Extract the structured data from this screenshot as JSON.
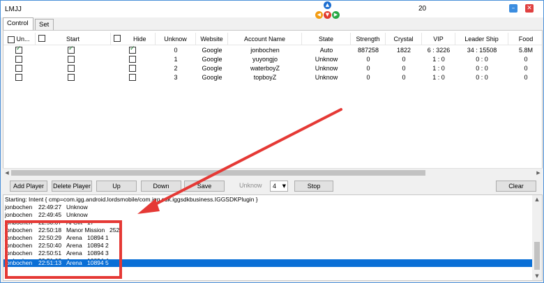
{
  "window": {
    "title": "LMJJ",
    "counter": "20",
    "minimize_icon": "minimize-icon",
    "close_icon": "close-icon"
  },
  "dpad": {
    "up": "▲",
    "left": "◀",
    "down": "▼",
    "right": "▶"
  },
  "tabs": [
    {
      "label": "Control",
      "active": true
    },
    {
      "label": "Set",
      "active": false
    }
  ],
  "grid": {
    "columns": [
      "Un...",
      "Start",
      "Hide",
      "Unknow",
      "Website",
      "Account Name",
      "State",
      "Strength",
      "Crystal",
      "VIP",
      "Leader Ship",
      "Food"
    ],
    "rows": [
      {
        "un": true,
        "start": true,
        "hide": true,
        "unknow": "0",
        "website": "Google",
        "account": "jonbochen",
        "state": "Auto",
        "strength": "887258",
        "crystal": "1822",
        "vip": "6 : 3226",
        "leadership": "34 : 15508",
        "food": "5.8M"
      },
      {
        "un": false,
        "start": false,
        "hide": false,
        "unknow": "1",
        "website": "Google",
        "account": "yuyongjo",
        "state": "Unknow",
        "strength": "0",
        "crystal": "0",
        "vip": "1 : 0",
        "leadership": "0 : 0",
        "food": "0"
      },
      {
        "un": false,
        "start": false,
        "hide": false,
        "unknow": "2",
        "website": "Google",
        "account": "waterboyZ",
        "state": "Unknow",
        "strength": "0",
        "crystal": "0",
        "vip": "1 : 0",
        "leadership": "0 : 0",
        "food": "0"
      },
      {
        "un": false,
        "start": false,
        "hide": false,
        "unknow": "3",
        "website": "Google",
        "account": "topboyZ",
        "state": "Unknow",
        "strength": "0",
        "crystal": "0",
        "vip": "1 : 0",
        "leadership": "0 : 0",
        "food": "0"
      }
    ]
  },
  "toolbar": {
    "add_player": "Add Player",
    "delete_player": "Delete Player",
    "up": "Up",
    "down": "Down",
    "save": "Save",
    "unknow_label": "Unknow",
    "select_value": "4",
    "stop": "Stop",
    "clear": "Clear"
  },
  "log": {
    "lines": [
      {
        "name": "Starting: Intent { cmp=com.igg.android.lordsmobile/com.igg.sdk.iggsdkbusiness.IGGSDKPlugin }",
        "time": "",
        "action": "",
        "value": ""
      },
      {
        "name": "jonbochen",
        "time": "22:49:27",
        "action": "Unknow",
        "value": ""
      },
      {
        "name": "jonbochen",
        "time": "22:49:45",
        "action": "Unknow",
        "value": ""
      },
      {
        "name": "jonbochen",
        "time": "22:50:07",
        "action": "Al Gift",
        "value": "17"
      },
      {
        "name": "jonbochen",
        "time": "22:50:18",
        "action": "Manor Mission",
        "value": "252"
      },
      {
        "name": "jonbochen",
        "time": "22:50:29",
        "action": "Arena",
        "value": "10894 1"
      },
      {
        "name": "jonbochen",
        "time": "22:50:40",
        "action": "Arena",
        "value": "10894 2"
      },
      {
        "name": "jonbochen",
        "time": "22:50:51",
        "action": "Arena",
        "value": "10894 3"
      },
      {
        "name": "jonbochen",
        "time": "22:51:02",
        "action": "Arena",
        "value": "10894 4"
      },
      {
        "name": "jonbochen",
        "time": "22:51:13",
        "action": "Arena",
        "value": "10894 5"
      }
    ],
    "selected_index": 9
  },
  "colors": {
    "selection": "#0a6fd6",
    "annotation": "#e53935",
    "accent": "#4a90d9"
  }
}
